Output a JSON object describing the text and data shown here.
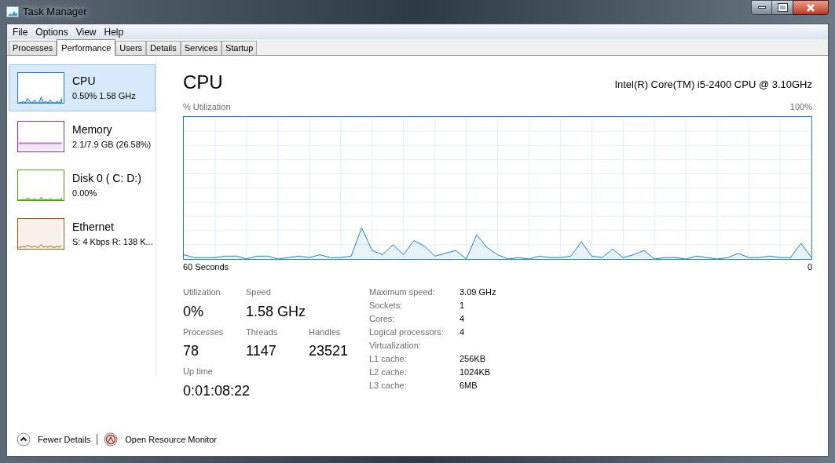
{
  "window": {
    "title": "Task Manager"
  },
  "menu": [
    "File",
    "Options",
    "View",
    "Help"
  ],
  "tabs": [
    {
      "label": "Processes",
      "selected": false
    },
    {
      "label": "Performance",
      "selected": true
    },
    {
      "label": "Users",
      "selected": false
    },
    {
      "label": "Details",
      "selected": false
    },
    {
      "label": "Services",
      "selected": false
    },
    {
      "label": "Startup",
      "selected": false
    }
  ],
  "sidebar": {
    "items": [
      {
        "kind": "spikes",
        "name": "CPU",
        "detail": "0.50%  1.58 GHz",
        "color": "#1a83c8",
        "selected": true
      },
      {
        "kind": "band",
        "name": "Memory",
        "detail": "2.1/7.9 GB (26.58%)",
        "color": "#9a28b8",
        "selected": false
      },
      {
        "kind": "spikes",
        "name": "Disk 0 ( C: D:)",
        "detail": "0.00%",
        "color": "#4da60e",
        "selected": false
      },
      {
        "kind": "filled",
        "name": "Ethernet",
        "detail": "S: 4 Kbps R: 138 K...",
        "color": "#a75200",
        "selected": false
      }
    ]
  },
  "main": {
    "title": "CPU",
    "processor": "Intel(R) Core(TM) i5-2400 CPU @ 3.10GHz",
    "graph": {
      "y_label": "% Utilization",
      "y_max": "100%",
      "x_label": "60 Seconds",
      "y_min": "0"
    },
    "stats": [
      {
        "label": "Utilization",
        "value": "0%"
      },
      {
        "label": "Speed",
        "value": "1.58 GHz"
      },
      {
        "label": "Processes",
        "value": "78"
      },
      {
        "label": "Threads",
        "value": "1147"
      },
      {
        "label": "Handles",
        "value": "23521"
      },
      {
        "label": "Up time",
        "value": "0:01:08:22"
      }
    ],
    "specs": [
      {
        "label": "Maximum speed:",
        "value": "3.09 GHz"
      },
      {
        "label": "Sockets:",
        "value": "1"
      },
      {
        "label": "Cores:",
        "value": "4"
      },
      {
        "label": "Logical processors:",
        "value": "4"
      },
      {
        "label": "Virtualization:"
      },
      {
        "label": "L1 cache:",
        "value": "256KB"
      },
      {
        "label": "L2 cache:",
        "value": "1024KB"
      },
      {
        "label": "L3 cache:",
        "value": "6MB"
      }
    ]
  },
  "footer": {
    "fewer_details": "Fewer Details",
    "resource_monitor": "Open Resource Monitor"
  }
}
